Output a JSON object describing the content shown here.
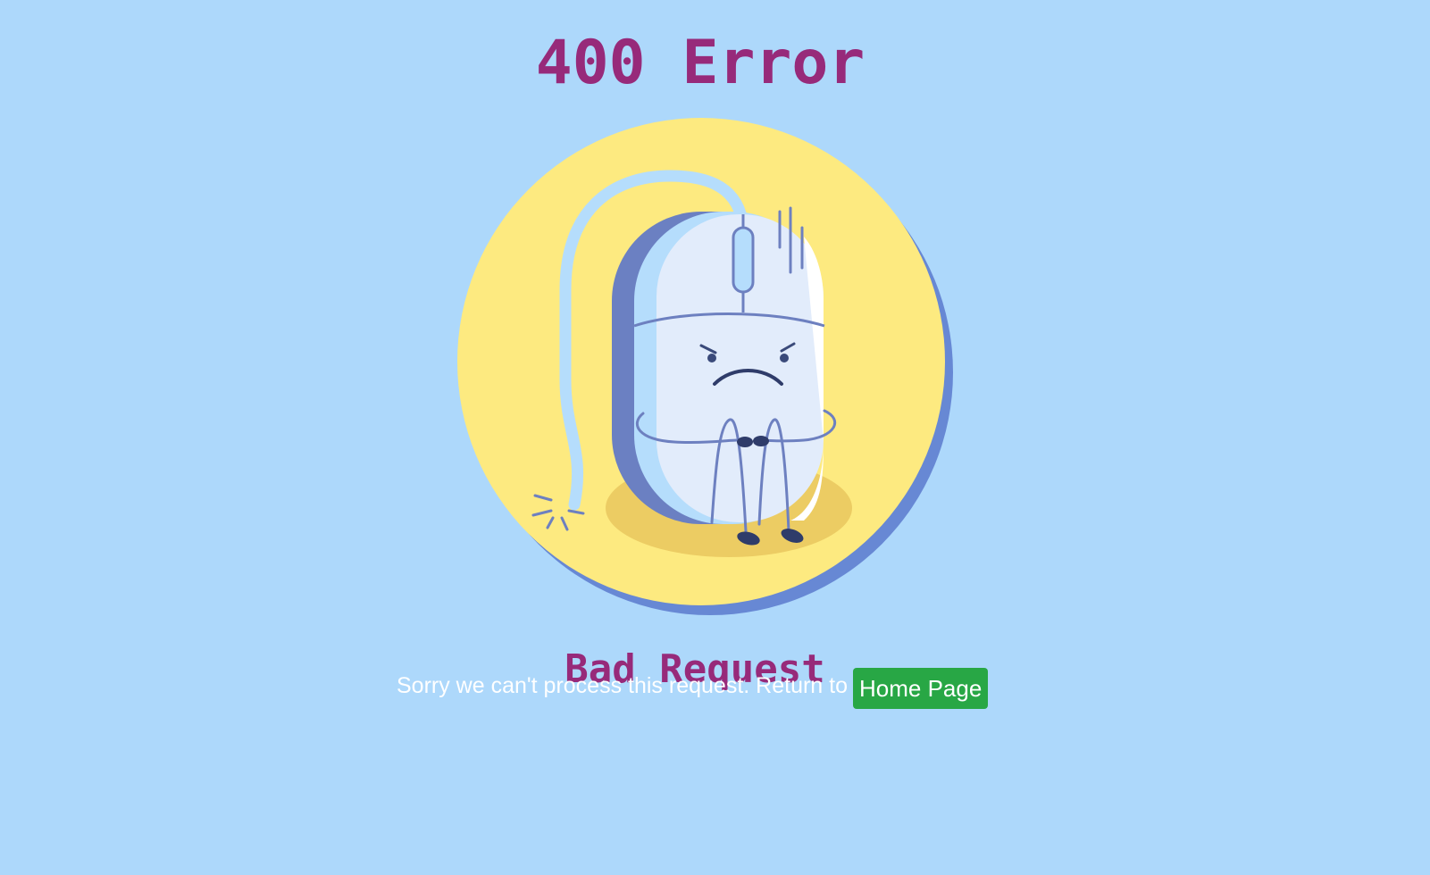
{
  "header": {
    "title": "400 Error"
  },
  "illustration": {
    "icon": "sad-computer-mouse-illustration"
  },
  "main": {
    "subtitle": "Bad Request",
    "message": "Sorry we can't process this request. Return to",
    "home_button_label": "Home Page"
  },
  "colors": {
    "background": "#add8fb",
    "title": "#972a7a",
    "button": "#28a745",
    "circle": "#fdea80",
    "circle_shadow": "#6788d4"
  }
}
